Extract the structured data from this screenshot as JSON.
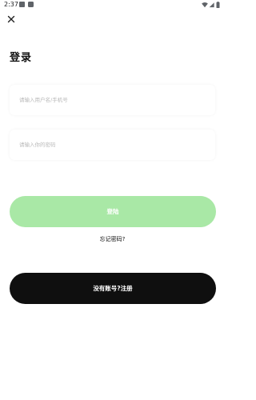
{
  "status_bar": {
    "time": "2:37"
  },
  "header": {
    "close_icon": "close-icon"
  },
  "page": {
    "title": "登录"
  },
  "form": {
    "username_placeholder": "请输入用户名/手机号",
    "password_placeholder": "请输入你的密码"
  },
  "actions": {
    "login_label": "登陆",
    "forgot_label": "忘记密码?",
    "register_label": "没有账号?注册"
  },
  "colors": {
    "login_button": "#a9e8a6",
    "register_button": "#0f0f0f",
    "text": "#111111",
    "placeholder": "#b9b9b9"
  }
}
